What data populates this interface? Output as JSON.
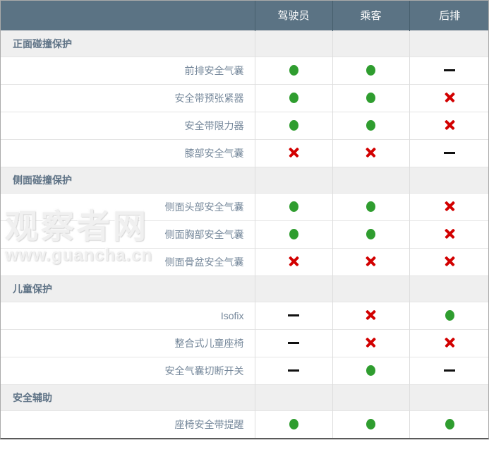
{
  "chart_data": {
    "type": "table",
    "columns": [
      "",
      "驾驶员",
      "乘客",
      "后排"
    ],
    "value_icons": {
      "yes": "green-dot",
      "no": "red-cross",
      "na": "black-dash"
    },
    "sections": [
      {
        "title": "正面碰撞保护",
        "rows": [
          {
            "label": "前排安全气囊",
            "values": [
              "yes",
              "yes",
              "na"
            ]
          },
          {
            "label": "安全带预张紧器",
            "values": [
              "yes",
              "yes",
              "no"
            ]
          },
          {
            "label": "安全带限力器",
            "values": [
              "yes",
              "yes",
              "no"
            ]
          },
          {
            "label": "膝部安全气囊",
            "values": [
              "no",
              "no",
              "na"
            ]
          }
        ]
      },
      {
        "title": "侧面碰撞保护",
        "rows": [
          {
            "label": "侧面头部安全气囊",
            "values": [
              "yes",
              "yes",
              "no"
            ]
          },
          {
            "label": "侧面胸部安全气囊",
            "values": [
              "yes",
              "yes",
              "no"
            ]
          },
          {
            "label": "侧面骨盆安全气囊",
            "values": [
              "no",
              "no",
              "no"
            ]
          }
        ]
      },
      {
        "title": "儿童保护",
        "rows": [
          {
            "label": "Isofix",
            "values": [
              "na",
              "no",
              "yes"
            ]
          },
          {
            "label": "整合式儿童座椅",
            "values": [
              "na",
              "no",
              "no"
            ]
          },
          {
            "label": "安全气囊切断开关",
            "values": [
              "na",
              "yes",
              "na"
            ]
          }
        ]
      },
      {
        "title": "安全辅助",
        "rows": [
          {
            "label": "座椅安全带提醒",
            "values": [
              "yes",
              "yes",
              "yes"
            ]
          }
        ]
      }
    ]
  },
  "watermark": {
    "line1": "观察者网",
    "line2": "www.guancha.cn"
  },
  "colors": {
    "header_bg": "#5b7384",
    "header_text": "#ffffff",
    "section_bg": "#efefef",
    "section_text": "#5f7386",
    "label_text": "#76889b",
    "available_green": "#2f9d2f",
    "unavailable_red": "#d20000",
    "dash_black": "#111111"
  }
}
